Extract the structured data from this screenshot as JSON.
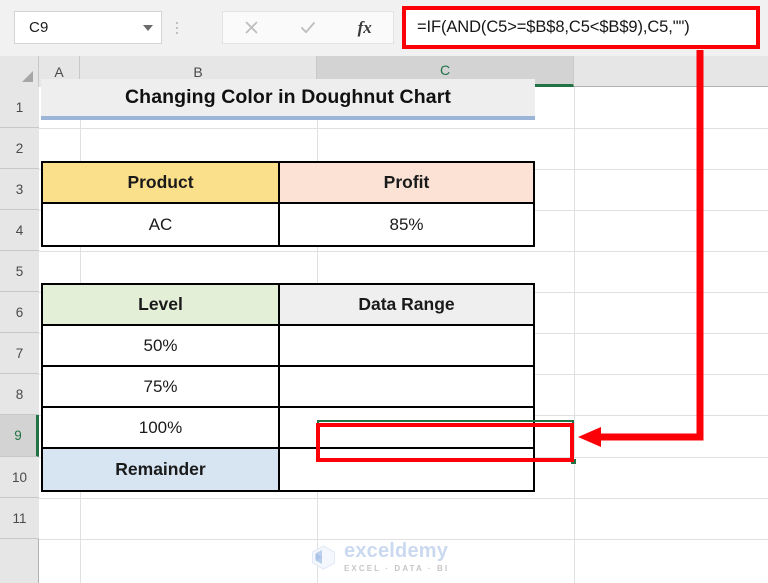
{
  "formula_bar": {
    "name_box_value": "C9",
    "name_box_icon": "chevron-down-icon",
    "cancel_icon": "cancel-x-icon",
    "enter_icon": "enter-check-icon",
    "function_icon": "fx-function-icon",
    "function_label": "fx",
    "formula_value": "=IF(AND(C5>=$B$8,C5<$B$9),C5,\"\")",
    "highlight_color": "#fb0007"
  },
  "grid": {
    "columns": [
      {
        "label": "A",
        "selected": false
      },
      {
        "label": "B",
        "selected": false
      },
      {
        "label": "C",
        "selected": true
      }
    ],
    "rows": [
      {
        "label": "1",
        "selected": false
      },
      {
        "label": "2",
        "selected": false
      },
      {
        "label": "3",
        "selected": false
      },
      {
        "label": "4",
        "selected": false
      },
      {
        "label": "5",
        "selected": false
      },
      {
        "label": "6",
        "selected": false
      },
      {
        "label": "7",
        "selected": false
      },
      {
        "label": "8",
        "selected": false
      },
      {
        "label": "9",
        "selected": true
      },
      {
        "label": "10",
        "selected": false
      },
      {
        "label": "11",
        "selected": false
      }
    ],
    "selection_color": "#217346",
    "active_cell": "C9"
  },
  "sheet": {
    "title": "Changing Color in Doughnut Chart",
    "title_underline_color": "#9cb4d8",
    "product_table": {
      "headers": [
        "Product",
        "Profit"
      ],
      "header_colors": [
        "#fbe08c",
        "#fbe2d5"
      ],
      "rows": [
        [
          "AC",
          "85%"
        ]
      ]
    },
    "level_table": {
      "headers": [
        "Level",
        "Data Range"
      ],
      "header_colors": [
        "#e4efd8",
        "#efefef"
      ],
      "rows": [
        [
          "50%",
          ""
        ],
        [
          "75%",
          ""
        ],
        [
          "100%",
          ""
        ],
        [
          "Remainder",
          ""
        ]
      ],
      "remainder_color": "#d7e5f3"
    }
  },
  "watermark": {
    "name": "exceldemy",
    "tagline": "EXCEL · DATA · BI",
    "logo_icon": "exceldemy-cube-logo-icon"
  }
}
